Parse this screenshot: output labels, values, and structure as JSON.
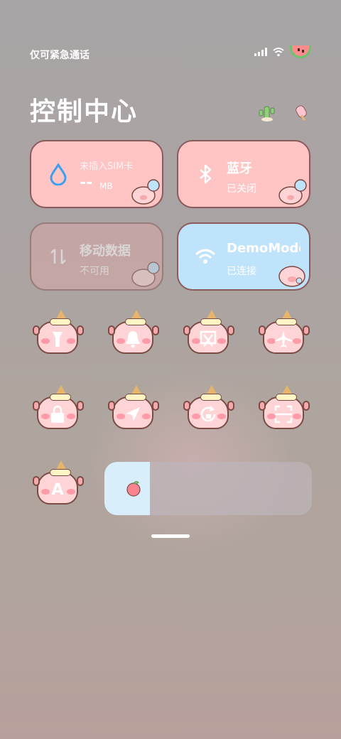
{
  "status_bar": {
    "carrier": "仅可紧急通话",
    "icons": [
      "signal-icon",
      "wifi-icon",
      "watermelon-battery-icon"
    ]
  },
  "header": {
    "title": "控制中心",
    "decorations": [
      "cactus-sticker-icon",
      "popsicle-sticker-icon"
    ]
  },
  "tiles": {
    "data_usage": {
      "title": "未插入SIM卡",
      "value": "--",
      "unit": "MB",
      "icon": "water-drop-icon"
    },
    "bluetooth": {
      "title": "蓝牙",
      "status": "已关闭",
      "icon": "bluetooth-icon"
    },
    "mobile_data": {
      "title": "移动数据",
      "status": "不可用",
      "icon": "data-arrows-icon"
    },
    "wifi": {
      "title": "DemoMode",
      "status": "已连接",
      "icon": "wifi-icon"
    }
  },
  "toggles": [
    {
      "name": "flashlight",
      "glyph": "flashlight-icon"
    },
    {
      "name": "bell",
      "glyph": "bell-icon"
    },
    {
      "name": "screenshot",
      "glyph": "screenshot-icon"
    },
    {
      "name": "airplane-mode",
      "glyph": "airplane-icon"
    },
    {
      "name": "lock-screen",
      "glyph": "lock-icon"
    },
    {
      "name": "location",
      "glyph": "location-arrow-icon"
    },
    {
      "name": "rotation-lock",
      "glyph": "rotation-lock-icon"
    },
    {
      "name": "scanner",
      "glyph": "scan-icon"
    },
    {
      "name": "font-size",
      "glyph": "A"
    }
  ],
  "brightness": {
    "level": 0.22,
    "icon": "peach-icon"
  },
  "colors": {
    "tile_pink": "#ffc4c4",
    "tile_blue": "#bfe3fb",
    "accent_blue": "#3aa0f0",
    "outline_brown": "#7a4b44"
  }
}
